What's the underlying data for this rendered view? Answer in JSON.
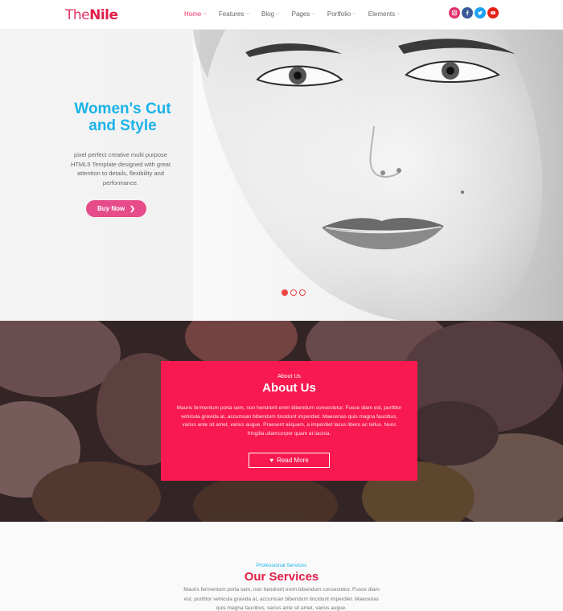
{
  "header": {
    "logo_a": "The",
    "logo_b": "Nile",
    "nav": [
      {
        "label": "Home"
      },
      {
        "label": "Features"
      },
      {
        "label": "Blog"
      },
      {
        "label": "Pages"
      },
      {
        "label": "Portfolio"
      },
      {
        "label": "Elements"
      }
    ],
    "social": [
      {
        "icon": "instagram-icon",
        "color": "#e1306c"
      },
      {
        "icon": "facebook-icon",
        "color": "#3b5998"
      },
      {
        "icon": "twitter-icon",
        "color": "#1da1f2"
      },
      {
        "icon": "youtube-icon",
        "color": "#e62117"
      }
    ]
  },
  "hero": {
    "title": "Women's Cut and Style",
    "description": "pixel perfect creative multi purpose HTML5 Template designed with great attention to details, flexibility and performance.",
    "button_label": "Buy Now",
    "slides": 3,
    "active_slide": 1
  },
  "about": {
    "kicker": "About Us",
    "title": "About Us",
    "text": "Mauris fermentum porta sem, non hendrerit enim bibendum consectetur. Fusce diam est, porttitor vehicula gravida at, accumsan bibendum tincidunt imperdiet. Maecenas quis magna faucibus, varius ante sit amet, varius augue. Praesent aliquam, a imperdiet lacus libero ac tellus. Nunc fringilla ullamcorper quam at lacinia.",
    "button_label": "Read More"
  },
  "services": {
    "kicker": "Professional Services",
    "title": "Our Services",
    "text": "Mauris fermentum porta sem, non hendrerit enim bibendum consectetur. Fusce diam est, porttitor vehicula gravida at, accumsan bibendum tincidunt imperdiet. Maecenas quis magna faucibus, varius ante sit amet, varius augue."
  },
  "colors": {
    "accent_pink": "#e33466",
    "brand_blue": "#1ab3e8",
    "about_card": "#f7194f",
    "button_pink": "#e74c8a"
  }
}
